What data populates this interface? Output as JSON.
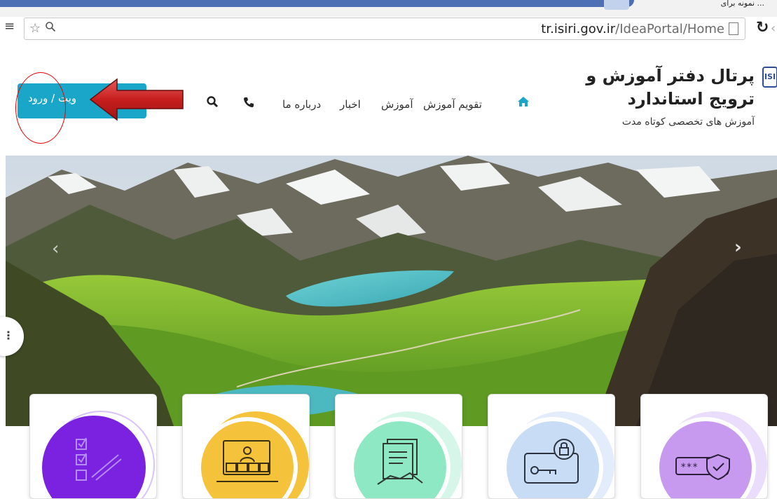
{
  "browser": {
    "corner_text": "... نمونه برای",
    "url_host": "tr.isiri.gov.ir",
    "url_path": "/IdeaPortal/Home"
  },
  "header": {
    "logo_text": "ISI",
    "title": "پرتال دفتر آموزش و ترویج استاندارد",
    "subtitle": "آموزش های تخصصی کوتاه مدت"
  },
  "nav": {
    "calendar": "تقویم آموزش",
    "training": "آموزش",
    "news": "اخبار",
    "about": "درباره ما"
  },
  "login": {
    "label": "عضویت / ورود",
    "visible_label": "ویت / ورود"
  },
  "icons": {
    "menu": "menu-icon",
    "star": "star-icon",
    "zoom": "zoom-icon",
    "reload": "reload-icon",
    "home": "home-icon",
    "phone": "phone-icon",
    "search": "search-icon"
  },
  "colors": {
    "accent": "#1aa6c8",
    "card_purple": "#7a22e0",
    "card_yellow": "#f5c23c",
    "card_green": "#8ee8c4",
    "card_blue": "#c9dcf5",
    "card_violet": "#c79af0"
  }
}
